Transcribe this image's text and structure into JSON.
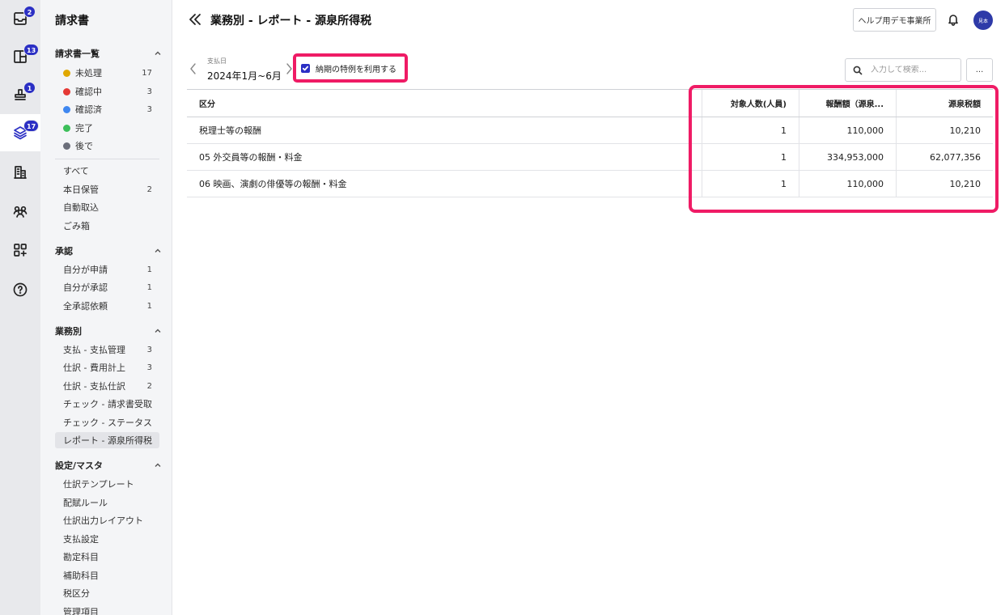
{
  "colors": {
    "accent": "#2b2fc4",
    "highlight": "#ef1b65",
    "status_unprocessed": "#e0a800",
    "status_checking": "#e53935",
    "status_checked": "#3f87f0",
    "status_done": "#3cbf5a",
    "status_later": "#6b6e7a"
  },
  "rail": {
    "items": [
      {
        "icon": "inbox-icon",
        "badge": "2"
      },
      {
        "icon": "layout-icon",
        "badge": "13"
      },
      {
        "icon": "stamp-icon",
        "badge": "1"
      },
      {
        "icon": "layers-icon",
        "badge": "17"
      },
      {
        "icon": "building-icon",
        "badge": ""
      },
      {
        "icon": "people-icon",
        "badge": ""
      },
      {
        "icon": "apps-add-icon",
        "badge": ""
      },
      {
        "icon": "help-icon",
        "badge": ""
      }
    ]
  },
  "sidebar": {
    "title": "請求書",
    "invoice_list": {
      "heading": "請求書一覧",
      "statuses": [
        {
          "label": "未処理",
          "count": "17"
        },
        {
          "label": "確認中",
          "count": "3"
        },
        {
          "label": "確認済",
          "count": "3"
        },
        {
          "label": "完了",
          "count": ""
        },
        {
          "label": "後で",
          "count": ""
        }
      ],
      "others": [
        {
          "label": "すべて",
          "count": ""
        },
        {
          "label": "本日保管",
          "count": "2"
        },
        {
          "label": "自動取込",
          "count": ""
        },
        {
          "label": "ごみ箱",
          "count": ""
        }
      ]
    },
    "approval": {
      "heading": "承認",
      "items": [
        {
          "label": "自分が申請",
          "count": "1"
        },
        {
          "label": "自分が承認",
          "count": "1"
        },
        {
          "label": "全承認依頼",
          "count": "1"
        }
      ]
    },
    "business": {
      "heading": "業務別",
      "items": [
        {
          "label": "支払 - 支払管理",
          "count": "3"
        },
        {
          "label": "仕訳 - 費用計上",
          "count": "3"
        },
        {
          "label": "仕訳 - 支払仕訳",
          "count": "2"
        },
        {
          "label": "チェック - 請求書受取",
          "count": ""
        },
        {
          "label": "チェック - ステータス",
          "count": ""
        },
        {
          "label": "レポート - 源泉所得税",
          "count": ""
        }
      ]
    },
    "settings": {
      "heading": "設定/マスタ",
      "items": [
        {
          "label": "仕訳テンプレート"
        },
        {
          "label": "配賦ルール"
        },
        {
          "label": "仕訳出力レイアウト"
        },
        {
          "label": "支払設定"
        },
        {
          "label": "勘定科目"
        },
        {
          "label": "補助科目"
        },
        {
          "label": "税区分"
        },
        {
          "label": "管理項目"
        }
      ]
    }
  },
  "header": {
    "title": "業務別 - レポート - 源泉所得税",
    "help_button": "ヘルプ用デモ事業所",
    "avatar_text": "見本"
  },
  "filters": {
    "date_label": "支払日",
    "date_value": "2024年1月~6月",
    "checkbox_label": "納期の特例を利用する",
    "checkbox_checked": true,
    "search_placeholder": "入力して検索...",
    "more_label": "..."
  },
  "table": {
    "columns": [
      "区分",
      "対象人数(人員)",
      "報酬額（源泉...",
      "源泉税額"
    ],
    "rows": [
      {
        "category": "税理士等の報酬",
        "people": "1",
        "amount": "110,000",
        "tax": "10,210"
      },
      {
        "category": "05 外交員等の報酬・料金",
        "people": "1",
        "amount": "334,953,000",
        "tax": "62,077,356"
      },
      {
        "category": "06 映画、演劇の俳優等の報酬・料金",
        "people": "1",
        "amount": "110,000",
        "tax": "10,210"
      }
    ]
  }
}
